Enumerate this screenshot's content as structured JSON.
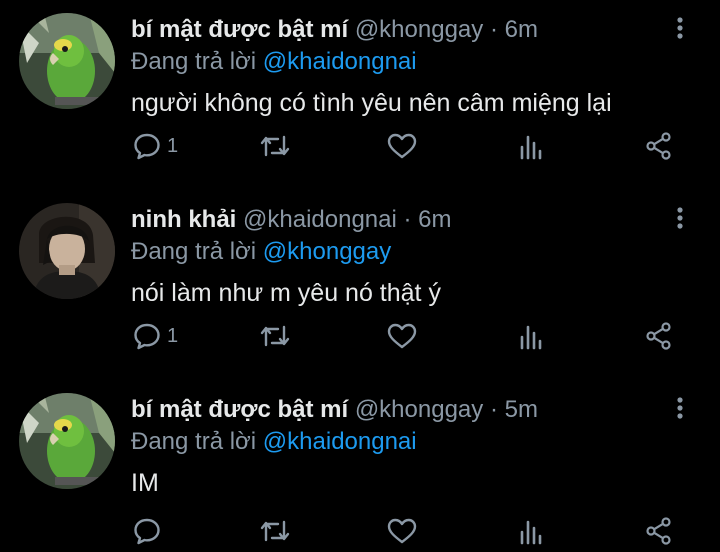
{
  "tweets": [
    {
      "display_name": "bí mật được bật mí",
      "handle": "@khonggay",
      "separator": "·",
      "time": "6m",
      "replying_prefix": "Đang trả lời",
      "replying_to": "@khaidongnai",
      "text": "người không có tình yêu nên câm miệng lại",
      "reply_count": "1",
      "avatar_icon": "parrot-avatar"
    },
    {
      "display_name": "ninh khải",
      "handle": "@khaidongnai",
      "separator": "·",
      "time": "6m",
      "replying_prefix": "Đang trả lời",
      "replying_to": "@khonggay",
      "text": "nói làm như m yêu nó thật ý",
      "reply_count": "1",
      "avatar_icon": "person-avatar"
    },
    {
      "display_name": "bí mật được bật mí",
      "handle": "@khonggay",
      "separator": "·",
      "time": "5m",
      "replying_prefix": "Đang trả lời",
      "replying_to": "@khaidongnai",
      "text": "IM",
      "reply_count": "",
      "avatar_icon": "parrot-avatar"
    }
  ],
  "colors": {
    "background": "#000000",
    "text": "#e7e9ea",
    "muted": "#8b98a5",
    "accent": "#1d9bf0"
  }
}
